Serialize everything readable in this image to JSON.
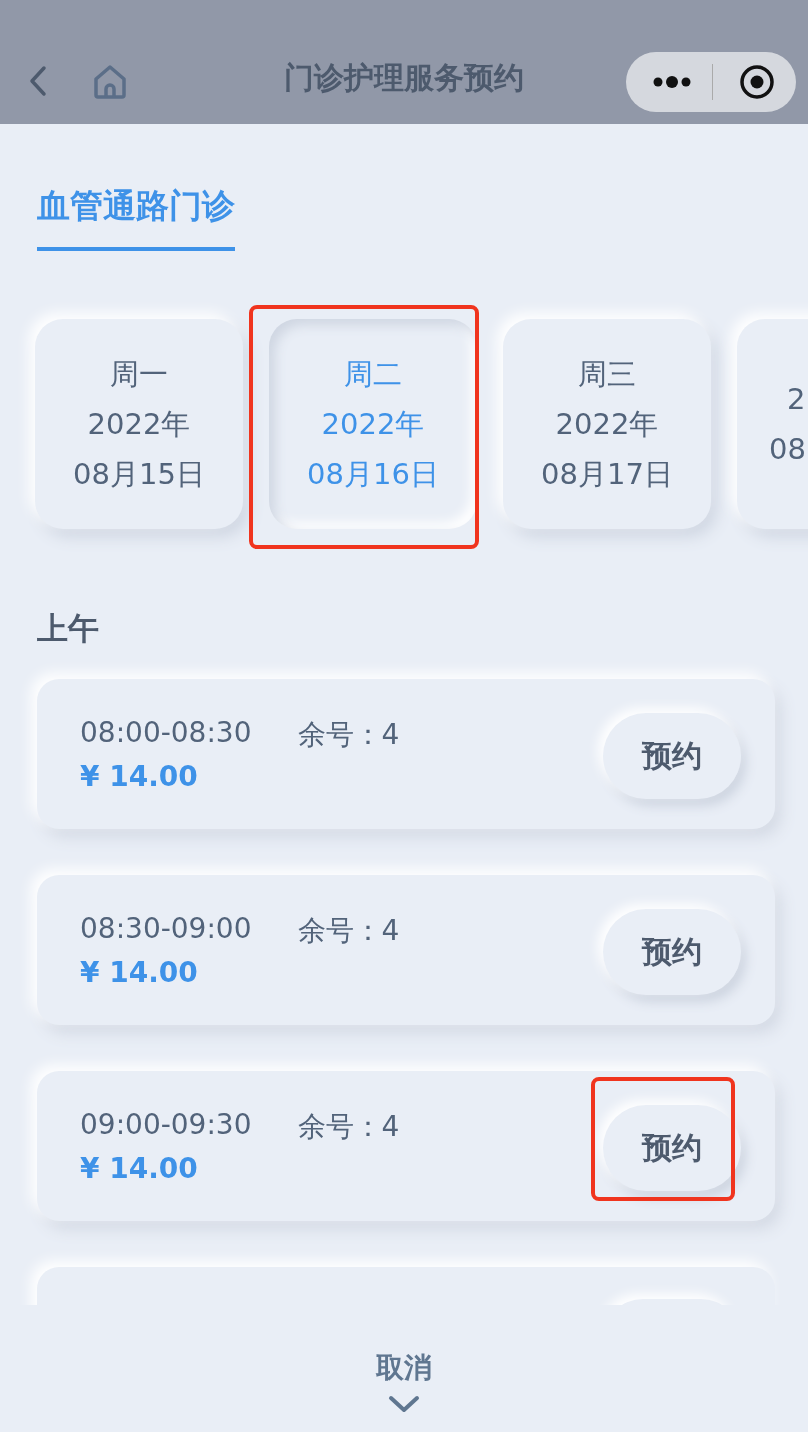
{
  "nav": {
    "title": "门诊护理服务预约"
  },
  "tabs": [
    {
      "label": "血管通路门诊",
      "selected": true
    }
  ],
  "days": [
    {
      "weekday": "周一",
      "year": "2022年",
      "date": "08月15日",
      "selected": false,
      "highlighted": false
    },
    {
      "weekday": "周二",
      "year": "2022年",
      "date": "08月16日",
      "selected": true,
      "highlighted": true
    },
    {
      "weekday": "周三",
      "year": "2022年",
      "date": "08月17日",
      "selected": false,
      "highlighted": false
    },
    {
      "year": "2",
      "date": "08",
      "selected": false,
      "highlighted": false
    }
  ],
  "session": "上午",
  "slots": [
    {
      "kind": "slot",
      "time": "08:00-08:30",
      "remaining": "余号：4",
      "price": "¥ 14.00",
      "button": "预约",
      "highlighted": false
    },
    {
      "kind": "slot",
      "time": "08:30-09:00",
      "remaining": "余号：4",
      "price": "¥ 14.00",
      "button": "预约",
      "highlighted": false
    },
    {
      "kind": "slot",
      "time": "09:00-09:30",
      "remaining": "余号：4",
      "price": "¥ 14.00",
      "button": "预约",
      "highlighted": true
    },
    {
      "kind": "peek"
    }
  ],
  "footer": {
    "cancel": "取消"
  }
}
